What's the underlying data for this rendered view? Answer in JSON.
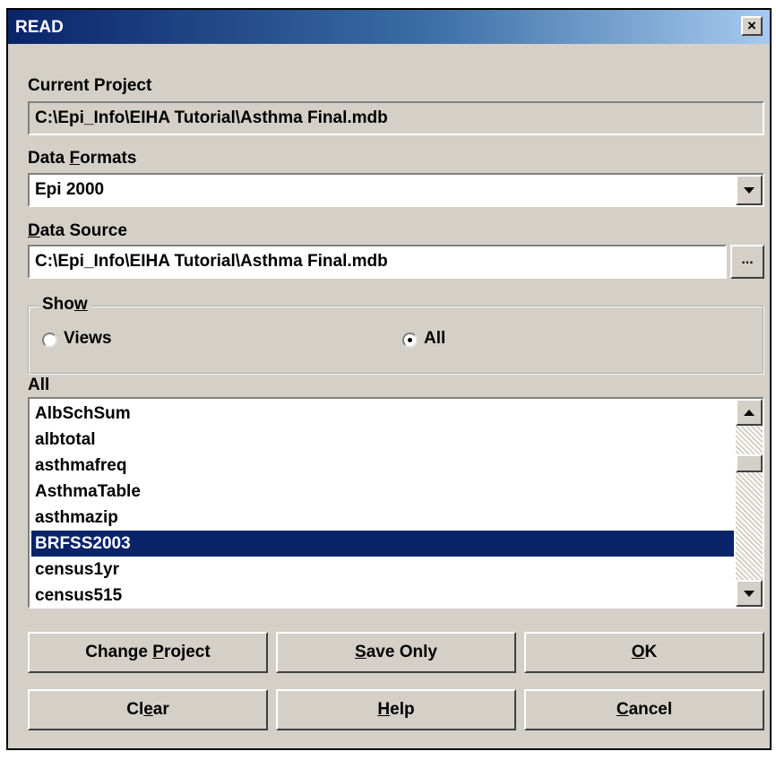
{
  "window": {
    "title": "READ",
    "close_glyph": "×"
  },
  "current_project": {
    "label": "Current Project",
    "value": "C:\\Epi_Info\\EIHA Tutorial\\Asthma Final.mdb"
  },
  "data_formats": {
    "label_pre": "Data ",
    "label_key": "F",
    "label_post": "ormats",
    "selected": "Epi 2000"
  },
  "data_source": {
    "label_key": "D",
    "label_post": "ata Source",
    "value": "C:\\Epi_Info\\EIHA Tutorial\\Asthma Final.mdb",
    "browse_label": "..."
  },
  "show": {
    "label_pre": "Sho",
    "label_key": "w",
    "options": [
      {
        "label": "Views",
        "checked": false
      },
      {
        "label": "All",
        "checked": true
      }
    ]
  },
  "list": {
    "label": "All",
    "items": [
      "AlbSchSum",
      "albtotal",
      "asthmafreq",
      "AsthmaTable",
      "asthmazip",
      "BRFSS2003",
      "census1yr",
      "census515"
    ],
    "selected_index": 5
  },
  "buttons": {
    "change_project": {
      "pre": "Change ",
      "key": "P",
      "post": "roject"
    },
    "save_only": {
      "pre": "",
      "key": "S",
      "post": "ave Only"
    },
    "ok": {
      "pre": "",
      "key": "O",
      "post": "K"
    },
    "clear": {
      "pre": "Cl",
      "key": "e",
      "post": "ar"
    },
    "help": {
      "pre": "",
      "key": "H",
      "post": "elp"
    },
    "cancel": {
      "pre": "",
      "key": "C",
      "post": "ancel"
    }
  },
  "colors": {
    "title_bar": "#0a246a",
    "dialog_face": "#d4d0c8",
    "selection": "#0a246a"
  }
}
